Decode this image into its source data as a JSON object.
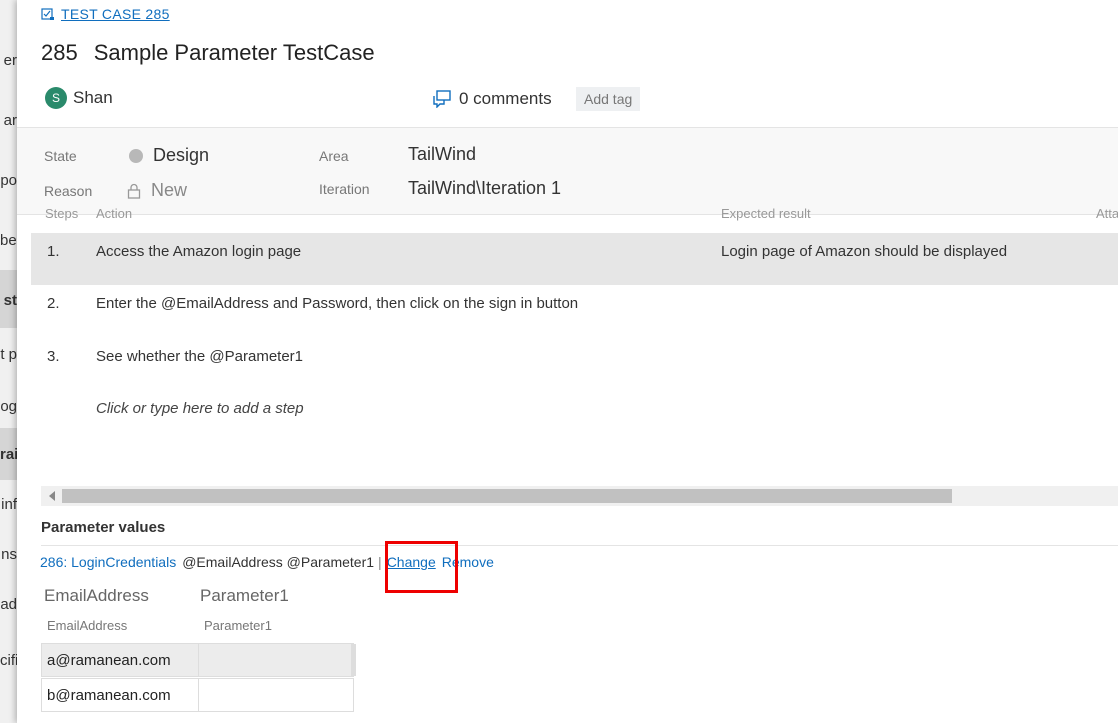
{
  "background_nav": {
    "fragments": [
      "er",
      "ar",
      "po",
      "bel",
      "st",
      "t p",
      "og",
      "rai",
      "inf",
      "ns",
      "ad",
      "cifi"
    ]
  },
  "work_item": {
    "type_link": "TEST CASE 285",
    "id": "285",
    "title": "Sample Parameter TestCase",
    "assignee_initial": "S",
    "assignee_name": "Shan",
    "comments": "0 comments",
    "add_tag": "Add tag"
  },
  "fields": {
    "state_label": "State",
    "state_value": "Design",
    "reason_label": "Reason",
    "reason_value": "New",
    "area_label": "Area",
    "area_value": "TailWind",
    "iteration_label": "Iteration",
    "iteration_value": "TailWind\\Iteration 1"
  },
  "steps": {
    "headers": {
      "steps": "Steps",
      "action": "Action",
      "expected": "Expected result",
      "attachments": "Atta"
    },
    "rows": [
      {
        "num": "1.",
        "action": "Access the Amazon login page",
        "expected": "Login page of Amazon should be displayed"
      },
      {
        "num": "2.",
        "action": "Enter the @EmailAddress and Password, then click on the sign in button",
        "expected": ""
      },
      {
        "num": "3.",
        "action": "See whether the  @Parameter1",
        "expected": ""
      }
    ],
    "add_step": "Click or type here to add a step"
  },
  "parameters": {
    "section_title": "Parameter values",
    "shared_set_link": "286: LoginCredentials",
    "shared_set_params": "@EmailAddress @Parameter1",
    "separator": "|",
    "change": "Change",
    "remove": "Remove",
    "columns": [
      "EmailAddress",
      "Parameter1"
    ],
    "subcolumns": [
      "EmailAddress",
      "Parameter1"
    ],
    "rows": [
      [
        "a@ramanean.com",
        ""
      ],
      [
        "b@ramanean.com",
        ""
      ]
    ]
  },
  "colors": {
    "link": "#106ebe",
    "avatar": "#2a8a6b",
    "highlight": "#e00000"
  }
}
